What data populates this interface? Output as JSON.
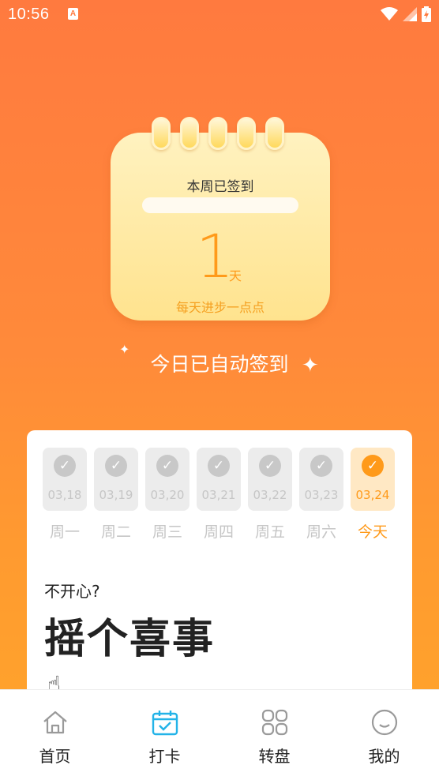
{
  "status_bar": {
    "time": "10:56",
    "app_icon": "A"
  },
  "calendar": {
    "title": "本周已签到",
    "days": "1",
    "unit": "天",
    "motto": "每天进步一点点"
  },
  "auto_sign_text": "今日已自动签到",
  "week": [
    {
      "date": "03,18",
      "label": "周一",
      "checked": true,
      "today": false
    },
    {
      "date": "03,19",
      "label": "周二",
      "checked": true,
      "today": false
    },
    {
      "date": "03,20",
      "label": "周三",
      "checked": true,
      "today": false
    },
    {
      "date": "03,21",
      "label": "周四",
      "checked": true,
      "today": false
    },
    {
      "date": "03,22",
      "label": "周五",
      "checked": true,
      "today": false
    },
    {
      "date": "03,23",
      "label": "周六",
      "checked": true,
      "today": false
    },
    {
      "date": "03,24",
      "label": "今天",
      "checked": true,
      "today": true
    }
  ],
  "shake": {
    "subtitle": "不开心?",
    "title": "摇个喜事"
  },
  "tabs": [
    {
      "label": "首页",
      "icon": "home-icon",
      "active": false
    },
    {
      "label": "打卡",
      "icon": "calendar-check-icon",
      "active": true
    },
    {
      "label": "转盘",
      "icon": "grid-icon",
      "active": false
    },
    {
      "label": "我的",
      "icon": "smile-icon",
      "active": false
    }
  ],
  "colors": {
    "accent": "#ff9a1a",
    "bg_top": "#ff7a3f",
    "bg_bottom": "#ffa62a",
    "tab_active": "#23b3e8",
    "tab_inactive": "#999999"
  }
}
